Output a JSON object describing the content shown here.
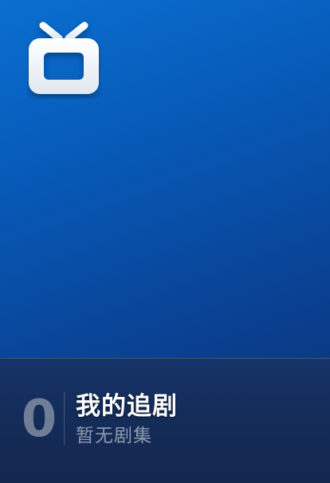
{
  "card": {
    "icon": "tv-icon",
    "count": "0",
    "title": "我的追剧",
    "subtitle": "暂无剧集"
  },
  "colors": {
    "background_top": "#0a6fd0",
    "background_bottom": "#0a2f70",
    "footer": "#142c59",
    "title": "#ffffff",
    "subtitle": "#8e99ad",
    "count": "#6f7d97"
  }
}
